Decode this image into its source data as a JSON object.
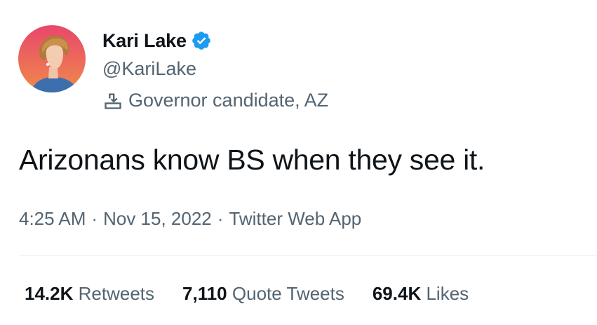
{
  "author": {
    "display_name": "Kari Lake",
    "handle": "@KariLake",
    "verified": true,
    "avatar_icon": "profile-photo",
    "label_icon": "ballot-box-icon",
    "label_text": "Governor candidate, AZ"
  },
  "tweet": {
    "text": "Arizonans know BS when they see it.",
    "time": "4:25 AM",
    "date": "Nov 15, 2022",
    "source": "Twitter Web App",
    "separator": "·"
  },
  "stats": {
    "retweets_count": "14.2K",
    "retweets_label": "Retweets",
    "quote_tweets_count": "7,110",
    "quote_tweets_label": "Quote Tweets",
    "likes_count": "69.4K",
    "likes_label": "Likes"
  },
  "colors": {
    "text_primary": "#0f1419",
    "text_secondary": "#536471",
    "verified_blue": "#1d9bf0",
    "avatar_bg_top": "#e8476a",
    "avatar_bg_bottom": "#f08a4b"
  }
}
